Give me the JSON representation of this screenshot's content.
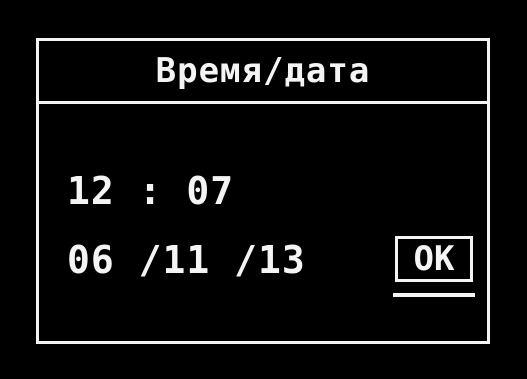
{
  "dialog": {
    "title": "Время/дата",
    "time": "12 : 07",
    "date": "06 /11 /13",
    "ok_label": "OK"
  },
  "colors": {
    "background": "#000000",
    "foreground": "#f4f4f4"
  }
}
